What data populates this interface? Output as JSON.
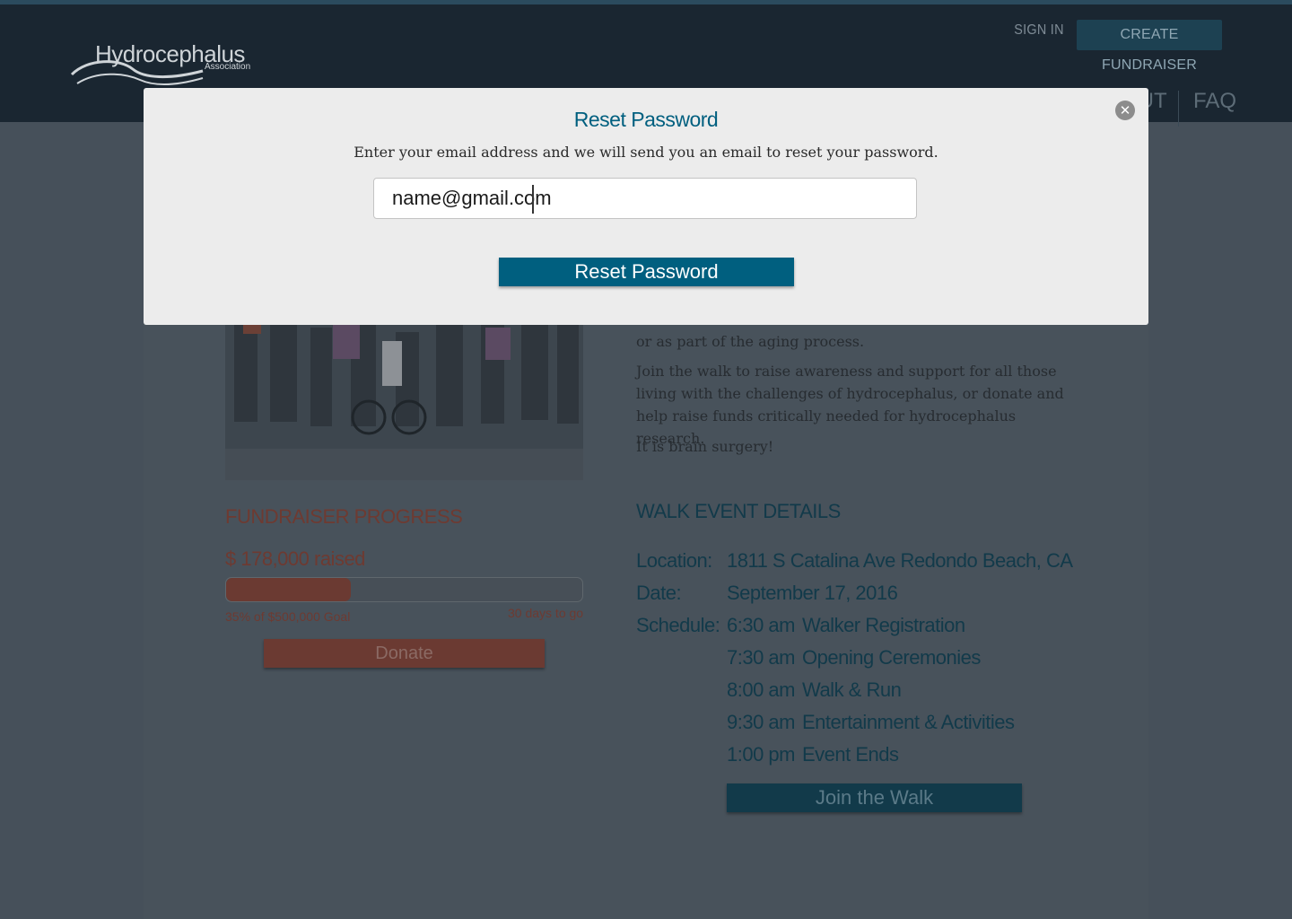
{
  "header": {
    "logo_title": "Hydrocephalus",
    "logo_subtitle": "Association",
    "sign_in": "SIGN IN",
    "create_fundraiser": "CREATE FUNDRAISER",
    "nav_about": "OUT",
    "nav_faq": "FAQ"
  },
  "description": {
    "p1": "or as part of the aging process.",
    "p2": "Join the walk to raise awareness and support for all those living with the challenges of hydrocephalus, or donate and help raise funds critically needed for hydrocephalus research.",
    "p3": "It is brain surgery!"
  },
  "fundraiser": {
    "title": "FUNDRAISER PROGRESS",
    "raised_amount": "$ 178,000",
    "raised_label": "raised",
    "progress_percent": 35,
    "goal_text": "35% of $500,000 Goal",
    "days_left": "30 days to go",
    "donate_label": "Donate"
  },
  "walk": {
    "title": "WALK EVENT DETAILS",
    "location_label": "Location:",
    "location_value": "1811 S Catalina Ave Redondo Beach, CA",
    "date_label": "Date:",
    "date_value": "September 17, 2016",
    "schedule_label": "Schedule:",
    "schedule": [
      {
        "time": "6:30 am",
        "event": "Walker Registration"
      },
      {
        "time": "7:30 am",
        "event": "Opening Ceremonies"
      },
      {
        "time": "8:00 am",
        "event": "Walk & Run"
      },
      {
        "time": "9:30 am",
        "event": "Entertainment & Activities"
      },
      {
        "time": "1:00 pm",
        "event": "Event Ends"
      }
    ],
    "join_label": "Join the Walk"
  },
  "modal": {
    "title": "Reset Password",
    "instruction": "Enter your email address and we will send you an email to reset your password.",
    "email_value": "name@gmail.com",
    "submit_label": "Reset Password",
    "close_icon": "close-icon"
  },
  "colors": {
    "accent": "#005f7f",
    "donate": "#6b3a32",
    "header_bg": "#1a2631"
  }
}
